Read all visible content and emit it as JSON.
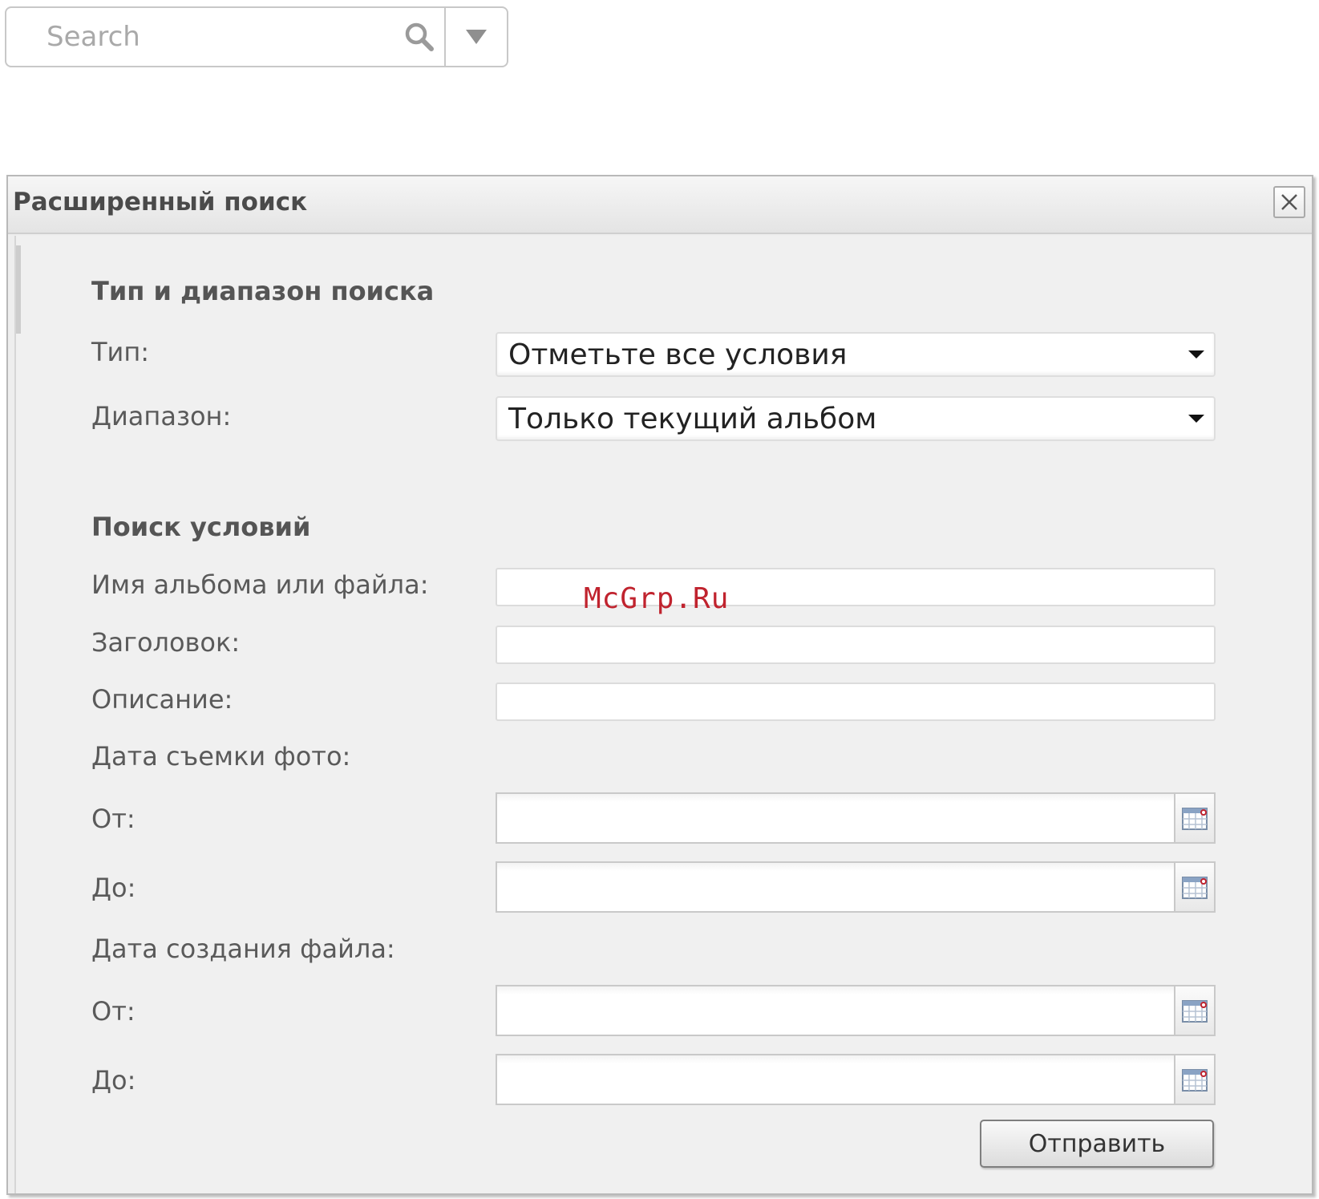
{
  "search": {
    "placeholder": "Search"
  },
  "dialog": {
    "title": "Расширенный поиск",
    "section_type": {
      "title": "Тип и диапазон поиска",
      "type_label": "Тип:",
      "type_value": "Отметьте все условия",
      "range_label": "Диапазон:",
      "range_value": "Только текущий альбом"
    },
    "section_conditions": {
      "title": "Поиск условий",
      "name_label": "Имя альбома или файла:",
      "name_value": "",
      "heading_label": "Заголовок:",
      "heading_value": "",
      "description_label": "Описание:",
      "description_value": "",
      "photo_date_label": "Дата съемки фото:",
      "photo_from_label": "От:",
      "photo_to_label": "До:",
      "file_date_label": "Дата создания файла:",
      "file_from_label": "От:",
      "file_to_label": "До:"
    },
    "submit_label": "Отправить"
  },
  "watermark": "McGrp.Ru",
  "icons": {
    "search": "search-icon",
    "dropdown": "triangle-down-icon",
    "close": "close-icon",
    "calendar": "calendar-icon"
  },
  "colors": {
    "dialog_bg": "#f0f0f0",
    "border": "#c8c8c8",
    "watermark": "#c0232e"
  }
}
